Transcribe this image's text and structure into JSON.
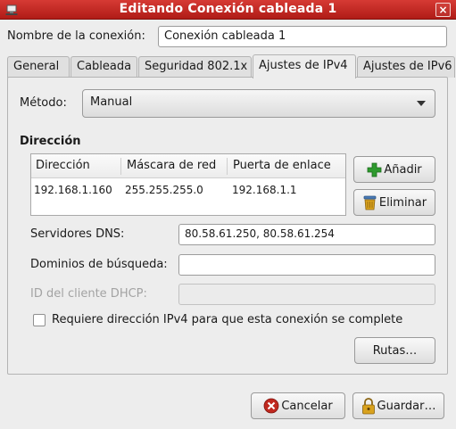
{
  "window": {
    "title": "Editando Conexión cableada 1",
    "close_glyph": "×",
    "icon": "network-wired-icon"
  },
  "connection_name": {
    "label": "Nombre de la conexión:",
    "value": "Conexión cableada 1"
  },
  "tabs": [
    {
      "label": "General",
      "active": false
    },
    {
      "label": "Cableada",
      "active": false
    },
    {
      "label": "Seguridad 802.1x",
      "active": false
    },
    {
      "label": "Ajustes de IPv4",
      "active": true
    },
    {
      "label": "Ajustes de IPv6",
      "active": false
    }
  ],
  "ipv4": {
    "method_label": "Método:",
    "method_value": "Manual",
    "addresses_title": "Dirección",
    "columns": [
      "Dirección",
      "Máscara de red",
      "Puerta de enlace"
    ],
    "rows": [
      [
        "192.168.1.160",
        "255.255.255.0",
        "192.168.1.1"
      ]
    ],
    "add_button": "Añadir",
    "delete_button": "Eliminar",
    "dns_label": "Servidores DNS:",
    "dns_value": "80.58.61.250, 80.58.61.254",
    "search_domains_label": "Dominios de búsqueda:",
    "search_domains_value": "",
    "dhcp_client_id_label": "ID del cliente DHCP:",
    "dhcp_client_id_value": "",
    "require_ipv4_label": "Requiere dirección IPv4 para que esta conexión se complete",
    "require_ipv4_checked": false,
    "routes_button": "Rutas…"
  },
  "footer": {
    "cancel_button": "Cancelar",
    "save_button": "Guardar…"
  },
  "colors": {
    "titlebar": "#c22a24",
    "add_icon": "#2e9a2e",
    "cancel_icon": "#c0281f",
    "lock_icon": "#d9a21d"
  }
}
